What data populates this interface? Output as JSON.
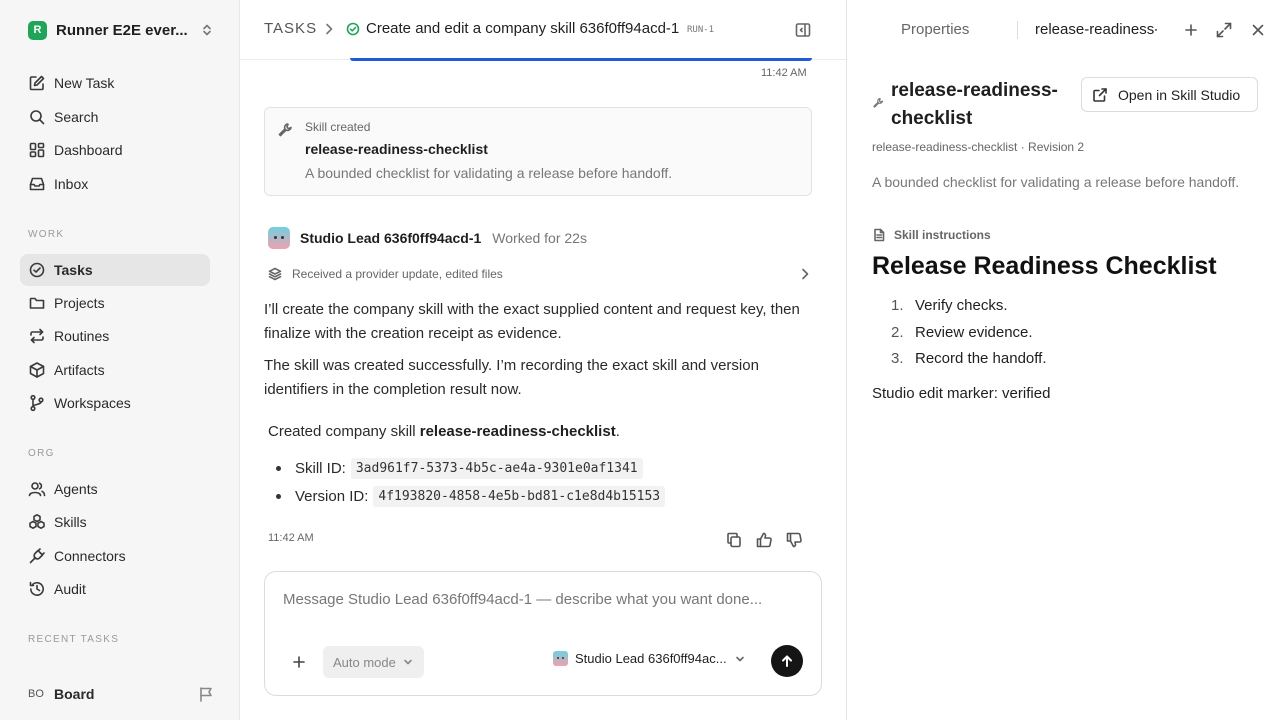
{
  "sidebar": {
    "workspace": {
      "initial": "R",
      "name": "Runner E2E ever..."
    },
    "primary": [
      {
        "label": "New Task",
        "icon": "edit-icon"
      },
      {
        "label": "Search",
        "icon": "search-icon"
      },
      {
        "label": "Dashboard",
        "icon": "dashboard-icon"
      },
      {
        "label": "Inbox",
        "icon": "inbox-icon"
      }
    ],
    "work_label": "WORK",
    "work": [
      {
        "label": "Tasks",
        "icon": "check-circle-icon",
        "active": true
      },
      {
        "label": "Projects",
        "icon": "folder-icon"
      },
      {
        "label": "Routines",
        "icon": "repeat-icon"
      },
      {
        "label": "Artifacts",
        "icon": "box-icon"
      },
      {
        "label": "Workspaces",
        "icon": "branch-icon"
      }
    ],
    "org_label": "ORG",
    "org": [
      {
        "label": "Agents",
        "icon": "users-icon"
      },
      {
        "label": "Skills",
        "icon": "skills-icon"
      },
      {
        "label": "Connectors",
        "icon": "plug-icon"
      },
      {
        "label": "Audit",
        "icon": "history-icon"
      }
    ],
    "recent_label": "RECENT TASKS",
    "board": {
      "initials": "BO",
      "label": "Board"
    }
  },
  "header": {
    "crumb_tasks": "TASKS",
    "task_title": "Create and edit a company skill 636f0ff94acd-1",
    "run_badge": "RUN-1"
  },
  "thread": {
    "time_top": "11:42 AM",
    "skill_card": {
      "label": "Skill created",
      "name": "release-readiness-checklist",
      "description": "A bounded checklist for validating a release before handoff."
    },
    "agent_name": "Studio Lead 636f0ff94acd-1",
    "worked": "Worked for 22s",
    "update_text": "Received a provider update, edited files",
    "para1": "I’ll create the company skill with the exact supplied content and request key, then finalize with the creation receipt as evidence.",
    "para2": "The skill was created successfully. I’m recording the exact skill and version identifiers in the completion result now.",
    "created_prefix": "Created company skill ",
    "created_name": "release-readiness-checklist",
    "created_suffix": ".",
    "skill_id_label": "Skill ID:",
    "skill_id": "3ad961f7-5373-4b5c-ae4a-9301e0af1341",
    "version_id_label": "Version ID:",
    "version_id": "4f193820-4858-4e5b-bd81-c1e8d4b15153",
    "time_bottom": "11:42 AM"
  },
  "composer": {
    "placeholder": "Message Studio Lead 636f0ff94acd-1 — describe what you want done...",
    "mode": "Auto mode",
    "agent": "Studio Lead 636f0ff94ac..."
  },
  "panel": {
    "tab_properties": "Properties",
    "tab_file": "release-readiness-checklist",
    "title": "release-readiness-checklist",
    "open_button": "Open in Skill Studio",
    "meta": "release-readiness-checklist · Revision 2",
    "description": "A bounded checklist for validating a release before handoff.",
    "instructions_label": "Skill instructions",
    "heading": "Release Readiness Checklist",
    "steps": [
      "Verify checks.",
      "Review evidence.",
      "Record the handoff."
    ],
    "marker": "Studio edit marker: verified"
  }
}
